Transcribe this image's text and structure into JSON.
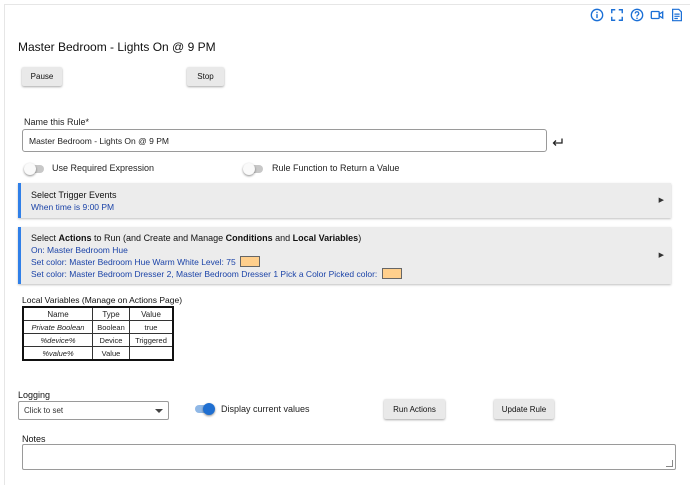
{
  "header": {
    "icons": [
      "info-icon",
      "fullscreen-icon",
      "help-icon",
      "video-icon",
      "document-icon"
    ],
    "title": "Master Bedroom - Lights On @ 9 PM"
  },
  "controls": {
    "pause_label": "Pause",
    "stop_label": "Stop"
  },
  "name_field": {
    "label": "Name this Rule*",
    "value": "Master Bedroom - Lights On @ 9 PM"
  },
  "toggles": {
    "required_expression": {
      "label": "Use Required Expression",
      "on": false
    },
    "rule_function": {
      "label": "Rule Function to Return a Value",
      "on": false
    }
  },
  "trigger_section": {
    "title": "Select Trigger Events",
    "line1": "When time is 9:00 PM"
  },
  "actions_section": {
    "title_part1": "Select ",
    "title_bold1": "Actions",
    "title_part2": " to Run (and Create and Manage ",
    "title_bold2": "Conditions",
    "title_part3": " and ",
    "title_bold3": "Local Variables",
    "title_part4": ")",
    "line1": "On: Master Bedroom Hue",
    "line2": "Set color: Master Bedroom Hue  Warm White  Level: 75",
    "line3": "Set color: Master Bedroom Dresser 2, Master Bedroom Dresser 1  Pick a Color  Picked color:",
    "swatch_color": "#ffcf8c"
  },
  "local_variables": {
    "title": "Local Variables",
    "subtitle": "(Manage on Actions Page)",
    "headers": [
      "Name",
      "Type",
      "Value"
    ],
    "rows": [
      [
        "Private Boolean",
        "Boolean",
        "true"
      ],
      [
        "%device%",
        "Device",
        "Triggered"
      ],
      [
        "%value%",
        "Value",
        ""
      ]
    ]
  },
  "logging": {
    "label": "Logging",
    "select_value": "Click to set"
  },
  "display_values": {
    "label": "Display current values",
    "on": true
  },
  "buttons": {
    "run_actions": "Run Actions",
    "update_rule": "Update Rule"
  },
  "notes": {
    "label": "Notes",
    "value": ""
  },
  "colors": {
    "accent": "#2f7fe8",
    "link_blue": "#1c44a8",
    "toggle_on": "#1f6fd1"
  }
}
